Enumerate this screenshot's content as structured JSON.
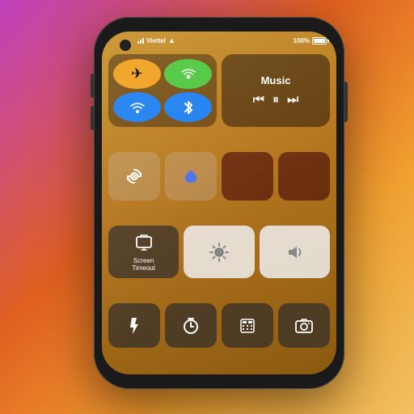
{
  "status_bar": {
    "carrier": "Viettel",
    "battery": "100%",
    "signal_label": "signal"
  },
  "connectivity": {
    "airplane_icon": "✈",
    "hotspot_icon": "📶",
    "wifi_icon": "📶",
    "bluetooth_icon": "🔵"
  },
  "music": {
    "title": "Music",
    "prev_icon": "⏮",
    "play_pause_icon": "⏸",
    "next_icon": "⏭"
  },
  "controls": {
    "rotation_icon": "🔒",
    "dnd_icon": "🌙",
    "screen_timeout_label": "Screen\nTimeout",
    "screen_timeout_icon": "⊙",
    "brightness_icon": "☀",
    "volume_icon": "🔊"
  },
  "quick_actions": {
    "flashlight_icon": "🔦",
    "timer_icon": "⏱",
    "calculator_icon": "🖩",
    "camera_icon": "📷"
  }
}
